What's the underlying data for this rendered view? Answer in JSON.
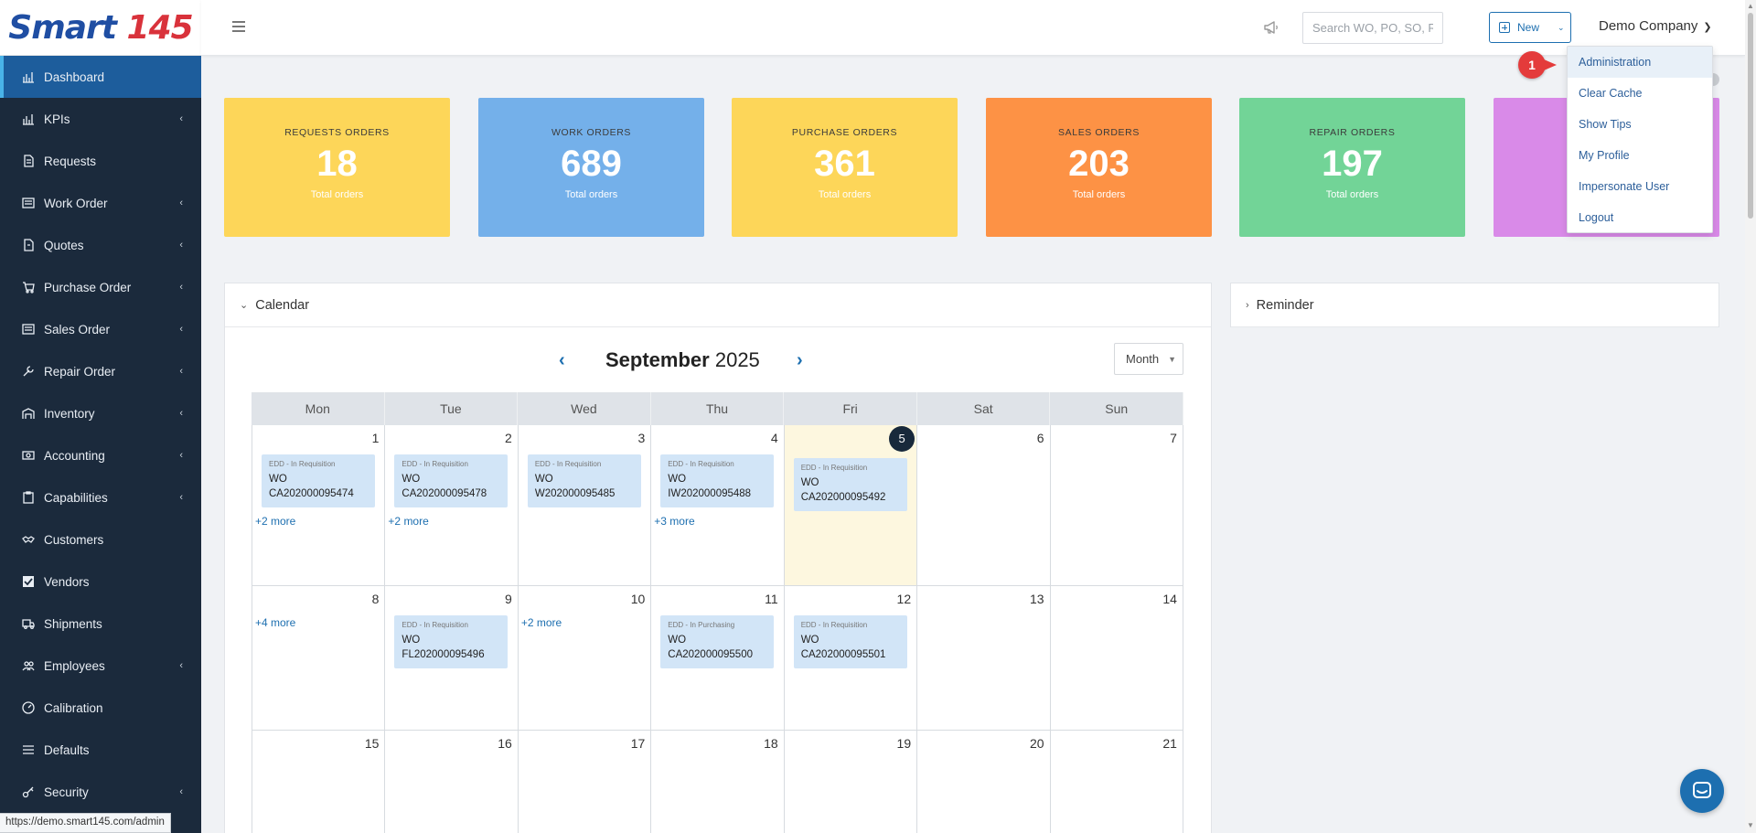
{
  "brand": {
    "name": "Smart",
    "number": "145"
  },
  "sidebar": {
    "items": [
      {
        "label": "Dashboard",
        "icon": "chart-icon",
        "active": true
      },
      {
        "label": "KPIs",
        "icon": "chart-icon",
        "chevron": "‹"
      },
      {
        "label": "Requests",
        "icon": "document-icon"
      },
      {
        "label": "Work Order",
        "icon": "list-icon",
        "chevron": "‹"
      },
      {
        "label": "Quotes",
        "icon": "quote-icon",
        "chevron": "‹"
      },
      {
        "label": "Purchase Order",
        "icon": "cart-icon",
        "chevron": "‹"
      },
      {
        "label": "Sales Order",
        "icon": "list-icon",
        "chevron": "‹"
      },
      {
        "label": "Repair Order",
        "icon": "wrench-icon",
        "chevron": "‹"
      },
      {
        "label": "Inventory",
        "icon": "warehouse-icon",
        "chevron": "‹"
      },
      {
        "label": "Accounting",
        "icon": "money-icon",
        "chevron": "‹"
      },
      {
        "label": "Capabilities",
        "icon": "clipboard-icon",
        "chevron": "‹"
      },
      {
        "label": "Customers",
        "icon": "handshake-icon"
      },
      {
        "label": "Vendors",
        "icon": "check-icon"
      },
      {
        "label": "Shipments",
        "icon": "truck-icon"
      },
      {
        "label": "Employees",
        "icon": "users-icon",
        "chevron": "‹"
      },
      {
        "label": "Calibration",
        "icon": "gauge-icon"
      },
      {
        "label": "Defaults",
        "icon": "lines-icon"
      },
      {
        "label": "Security",
        "icon": "key-icon",
        "chevron": "‹"
      }
    ]
  },
  "topbar": {
    "search_placeholder": "Search WO, PO, SO, RO",
    "new_label": "New",
    "company": "Demo Company"
  },
  "dropdown": {
    "items": [
      "Administration",
      "Clear Cache",
      "Show Tips",
      "My Profile",
      "Impersonate User",
      "Logout"
    ],
    "step_badge": "1"
  },
  "cards": [
    {
      "title": "REQUESTS ORDERS",
      "value": "18",
      "sub": "Total orders",
      "color": "#fdd659"
    },
    {
      "title": "WORK ORDERS",
      "value": "689",
      "sub": "Total orders",
      "color": "#74b0ea"
    },
    {
      "title": "PURCHASE ORDERS",
      "value": "361",
      "sub": "Total orders",
      "color": "#fdd659"
    },
    {
      "title": "SALES ORDERS",
      "value": "203",
      "sub": "Total orders",
      "color": "#fd9245"
    },
    {
      "title": "REPAIR ORDERS",
      "value": "197",
      "sub": "Total orders",
      "color": "#72d497"
    },
    {
      "title": "",
      "value": "",
      "sub": "",
      "color": "#d98ae8"
    }
  ],
  "calendar": {
    "panel_title": "Calendar",
    "month": "September",
    "year": "2025",
    "view": "Month",
    "weekdays": [
      "Mon",
      "Tue",
      "Wed",
      "Thu",
      "Fri",
      "Sat",
      "Sun"
    ],
    "weeks": [
      [
        {
          "day": "1",
          "events": [
            {
              "tag": "EDD - In Requisition",
              "name": "WO CA202000095474"
            }
          ],
          "more": "+2 more"
        },
        {
          "day": "2",
          "events": [
            {
              "tag": "EDD - In Requisition",
              "name": "WO CA202000095478"
            }
          ],
          "more": "+2 more"
        },
        {
          "day": "3",
          "events": [
            {
              "tag": "EDD - In Requisition",
              "name": "WO W202000095485"
            }
          ]
        },
        {
          "day": "4",
          "events": [
            {
              "tag": "EDD - In Requisition",
              "name": "WO IW202000095488"
            }
          ],
          "more": "+3 more"
        },
        {
          "day": "5",
          "today": true,
          "events": [
            {
              "tag": "EDD - In Requisition",
              "name": "WO CA202000095492"
            }
          ]
        },
        {
          "day": "6",
          "events": []
        },
        {
          "day": "7",
          "events": []
        }
      ],
      [
        {
          "day": "8",
          "events": [],
          "more": "+4 more"
        },
        {
          "day": "9",
          "events": [
            {
              "tag": "EDD - In Requisition",
              "name": "WO FL202000095496"
            }
          ]
        },
        {
          "day": "10",
          "events": [],
          "more": "+2 more"
        },
        {
          "day": "11",
          "events": [
            {
              "tag": "EDD - In Purchasing",
              "name": "WO CA202000095500"
            }
          ]
        },
        {
          "day": "12",
          "events": [
            {
              "tag": "EDD - In Requisition",
              "name": "WO CA202000095501"
            }
          ]
        },
        {
          "day": "13",
          "events": []
        },
        {
          "day": "14",
          "events": []
        }
      ],
      [
        {
          "day": "15",
          "events": []
        },
        {
          "day": "16",
          "events": []
        },
        {
          "day": "17",
          "events": []
        },
        {
          "day": "18",
          "events": []
        },
        {
          "day": "19",
          "events": []
        },
        {
          "day": "20",
          "events": []
        },
        {
          "day": "21",
          "events": []
        }
      ]
    ]
  },
  "reminder": {
    "panel_title": "Reminder"
  },
  "statusbar": {
    "url": "https://demo.smart145.com/admin"
  }
}
